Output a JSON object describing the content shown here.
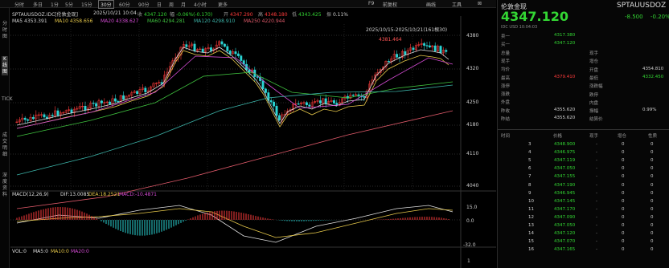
{
  "toolbar": {
    "tabs": [
      "分时",
      "多日",
      "1分",
      "5分",
      "15分",
      "30分",
      "60分",
      "90分",
      "日",
      "周",
      "月",
      "4小时",
      "更多"
    ],
    "active_tab": "30分",
    "right": [
      "F9",
      "画线",
      "工具"
    ],
    "extra": "前复权"
  },
  "sidebar": [
    "分时图",
    "K线图",
    "TICK",
    "成交明细",
    "深度资料"
  ],
  "chart": {
    "header": {
      "symbol": "SPTAUUSDOZ.IDC[伦敦金现]",
      "datetime": "2025/10/21 10:04",
      "open_label": "收",
      "open": "4347.120",
      "change_label": "幅",
      "change": "-0.06%(-0.170)",
      "high_label": "开",
      "high": "4347.290",
      "low_label": "高",
      "low": "4348.180",
      "close_label": "低",
      "close": "4343.425",
      "amp_label": "振",
      "amp": "0.11%"
    },
    "ma": {
      "ma5": "MA5 4353.391",
      "ma10": "MA10 4358.656",
      "ma20": "MA20 4338.627",
      "ma60": "MA60 4294.281",
      "ma120": "MA120 4298.910",
      "ma250": "MA250 4220.944"
    },
    "range_label": "2025/10/15-2025/10/21(161根30)",
    "peak_label": "4381.464",
    "price_axis": [
      "4380",
      "4320",
      "4250",
      "4180",
      "4110",
      "4040"
    ],
    "macd": {
      "title": "MACD(12,26,9)",
      "dif": "DIF:13.0085",
      "dea": "DEA:18.2521",
      "macd": "MACD:-10.4871",
      "axis": [
        "15.0",
        "0.0",
        "-32.0"
      ]
    },
    "vol": {
      "title": "VOL:0",
      "ma5": "MA5:0",
      "ma10": "MA10:0",
      "ma20": "MA20:0",
      "axis": [
        "1"
      ]
    }
  },
  "quote": {
    "name": "伦敦金现",
    "code": "SPTAUUSDOZ",
    "price": "4347.120",
    "change": "-8.500",
    "pct": "-0.20%",
    "sub": "IDC  USD  10:04:03",
    "rows_left": [
      {
        "label": "卖一",
        "value": "4317.380"
      },
      {
        "label": "买一",
        "value": "4347.120"
      },
      {
        "label": "总量",
        "value": ""
      },
      {
        "label": "现手",
        "value": ""
      },
      {
        "label": "均价",
        "value": ""
      },
      {
        "label": "最高",
        "value": "4379.410"
      },
      {
        "label": "涨停",
        "value": ""
      },
      {
        "label": "涨跌",
        "value": ""
      },
      {
        "label": "外盘",
        "value": ""
      },
      {
        "label": "昨收",
        "value": "4355.620"
      },
      {
        "label": "昨结",
        "value": "4355.620"
      }
    ],
    "rows_right": [
      {
        "label": "现手",
        "value": ""
      },
      {
        "label": "增仓",
        "value": ""
      },
      {
        "label": "开盘",
        "value": "4354.810"
      },
      {
        "label": "最低",
        "value": "4332.450"
      },
      {
        "label": "涨跌幅",
        "value": ""
      },
      {
        "label": "跌停",
        "value": ""
      },
      {
        "label": "内盘",
        "value": ""
      },
      {
        "label": "振幅",
        "value": "0.99%"
      },
      {
        "label": "结算价",
        "value": ""
      }
    ],
    "tick_headers": [
      "时间",
      "价格",
      "现手",
      "增仓",
      "性质"
    ],
    "ticks": [
      {
        "t": "3",
        "p": "4348.900",
        "h": "-",
        "z": "0",
        "x": "0"
      },
      {
        "t": "4",
        "p": "4346.975",
        "h": "-",
        "z": "0",
        "x": "0"
      },
      {
        "t": "5",
        "p": "4347.119",
        "h": "-",
        "z": "0",
        "x": "0"
      },
      {
        "t": "6",
        "p": "4347.050",
        "h": "-",
        "z": "0",
        "x": "0"
      },
      {
        "t": "7",
        "p": "4347.155",
        "h": "-",
        "z": "0",
        "x": "0"
      },
      {
        "t": "8",
        "p": "4347.190",
        "h": "-",
        "z": "0",
        "x": "0"
      },
      {
        "t": "9",
        "p": "4346.945",
        "h": "-",
        "z": "0",
        "x": "0"
      },
      {
        "t": "10",
        "p": "4347.145",
        "h": "-",
        "z": "0",
        "x": "0"
      },
      {
        "t": "11",
        "p": "4347.170",
        "h": "-",
        "z": "0",
        "x": "0"
      },
      {
        "t": "12",
        "p": "4347.090",
        "h": "-",
        "z": "0",
        "x": "0"
      },
      {
        "t": "13",
        "p": "4347.050",
        "h": "-",
        "z": "0",
        "x": "0"
      },
      {
        "t": "14",
        "p": "4347.120",
        "h": "-",
        "z": "0",
        "x": "0"
      },
      {
        "t": "15",
        "p": "4347.070",
        "h": "-",
        "z": "0",
        "x": "0"
      },
      {
        "t": "16",
        "p": "4347.165",
        "h": "-",
        "z": "0",
        "x": "0"
      }
    ]
  }
}
